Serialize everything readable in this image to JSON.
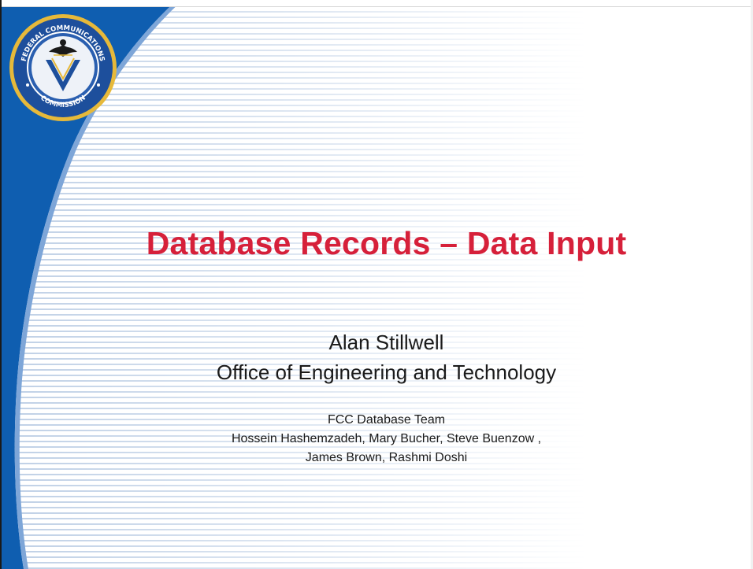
{
  "slide": {
    "title": "Database Records – Data Input",
    "presenter_name": "Alan Stillwell",
    "presenter_office": "Office of Engineering and Technology",
    "team_heading": "FCC Database Team",
    "team_members_line1": "Hossein Hashemzadeh, Mary Bucher, Steve Buenzow ,",
    "team_members_line2": "James Brown,  Rashmi Doshi"
  },
  "seal": {
    "text_top": "FEDERAL COMMUNICATIONS",
    "text_bottom": "COMMISSION"
  },
  "colors": {
    "title": "#d6203a",
    "swoosh": "#0f5eb0",
    "stripes": "#bfd0e6",
    "seal_ring": "#1d4f9c",
    "seal_gold": "#e6b93a"
  }
}
